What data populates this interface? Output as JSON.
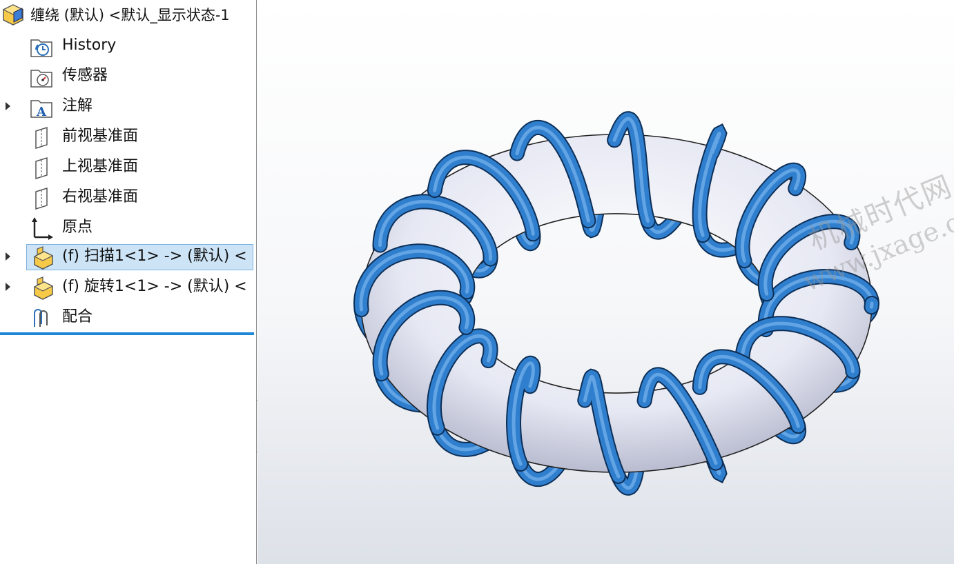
{
  "tree": {
    "root": {
      "label": "缠绕 (默认) <默认_显示状态-1",
      "icon": "part-icon"
    },
    "items": [
      {
        "label": "History",
        "icon": "history-folder-icon",
        "expandable": false
      },
      {
        "label": "传感器",
        "icon": "sensor-folder-icon",
        "expandable": false
      },
      {
        "label": "注解",
        "icon": "annotation-folder-icon",
        "expandable": true
      },
      {
        "label": "前视基准面",
        "icon": "plane-icon",
        "expandable": false
      },
      {
        "label": "上视基准面",
        "icon": "plane-icon",
        "expandable": false
      },
      {
        "label": "右视基准面",
        "icon": "plane-icon",
        "expandable": false
      },
      {
        "label": "原点",
        "icon": "origin-icon",
        "expandable": false
      },
      {
        "label": "(f) 扫描1<1> -> (默认) <",
        "icon": "component-icon",
        "expandable": true,
        "selected": true
      },
      {
        "label": "(f) 旋转1<1> -> (默认) <",
        "icon": "component-icon",
        "expandable": true
      },
      {
        "label": "配合",
        "icon": "mates-icon",
        "expandable": false
      }
    ]
  },
  "viewport": {
    "watermark": {
      "line1": "机械时代网",
      "line2": "www.jxage.com"
    },
    "colors": {
      "torus": "#e4e6f2",
      "coil": "#2f7fce",
      "selection": "#cde4f7",
      "rollback": "#1e88d6"
    }
  }
}
